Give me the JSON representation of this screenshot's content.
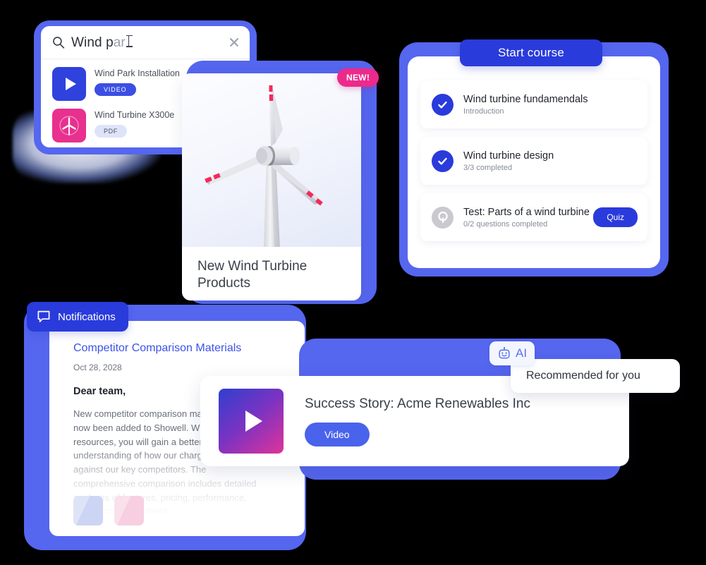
{
  "search": {
    "typed_text": "Wind p",
    "ghost_text": "ar",
    "icons": {
      "magnifier": "search-icon",
      "close": "close-icon",
      "caret": "text-cursor-icon"
    },
    "results": [
      {
        "title": "Wind Park Installation",
        "badge": "VIDEO",
        "thumb_type": "video",
        "thumb_color": "#2f42dd"
      },
      {
        "title": "Wind Turbine X300e",
        "badge": "PDF",
        "thumb_type": "pdf",
        "thumb_color": "#e8308f"
      }
    ]
  },
  "turbine_card": {
    "new_badge": "NEW!",
    "caption": "New Wind Turbine Products",
    "image_alt": "wind-turbine-illustration"
  },
  "course": {
    "start_button": "Start course",
    "items": [
      {
        "title": "Wind turbine fundamendals",
        "subtitle": "Introduction",
        "state": "done",
        "icon": "check-icon",
        "action": null
      },
      {
        "title": "Wind turbine design",
        "subtitle": "3/3 completed",
        "state": "done",
        "icon": "check-icon",
        "action": null
      },
      {
        "title": "Test: Parts of a wind turbine",
        "subtitle": "0/2 questions completed",
        "state": "pending",
        "icon": "question-icon",
        "action": "Quiz"
      }
    ]
  },
  "notifications": {
    "tab_label": "Notifications",
    "tab_icon": "speech-bubble-icon",
    "title": "Competitor Comparison Materials",
    "date": "Oct 28, 2028",
    "greeting": "Dear team,",
    "body": "New competitor comparison materials have now been added to Showell. With these resources, you will gain a better understanding of how our chargers stand up against our key competitors. The comprehensive comparison includes detailed analyses of features, pricing, performance, and customer feedback.",
    "attachments": [
      "attachment-thumbnail-1",
      "attachment-thumbnail-2"
    ]
  },
  "story": {
    "title": "Success Story: Acme Renewables Inc",
    "badge": "Video",
    "thumb_icon": "play-icon"
  },
  "ai": {
    "badge_label": "AI",
    "badge_icon": "robot-icon",
    "tooltip": "Recommended for you"
  },
  "colors": {
    "frame_blue": "#5566ef",
    "accent_blue": "#2a3bdb",
    "pink": "#e8308f",
    "badge_pink": "#ec2a8b",
    "link_blue": "#3b53e8",
    "muted_gray": "#868c98"
  }
}
